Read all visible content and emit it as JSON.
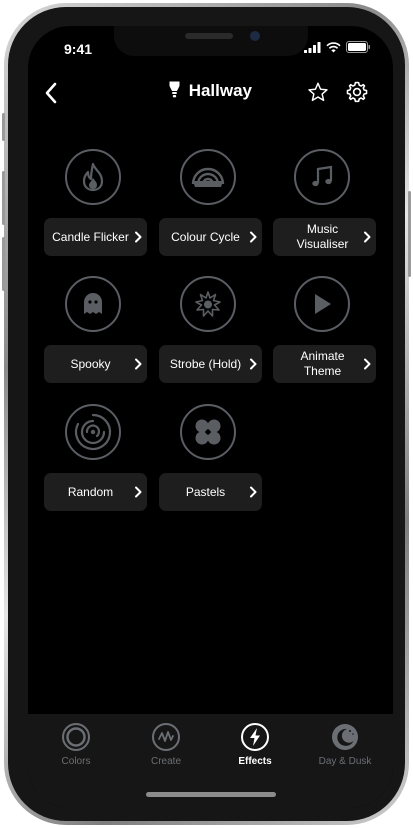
{
  "status": {
    "time": "9:41"
  },
  "header": {
    "title": "Hallway"
  },
  "effects": [
    {
      "label": "Candle Flicker",
      "icon": "flame-icon"
    },
    {
      "label": "Colour Cycle",
      "icon": "rainbow-icon"
    },
    {
      "label": "Music Visualiser",
      "icon": "music-note-icon"
    },
    {
      "label": "Spooky",
      "icon": "ghost-icon"
    },
    {
      "label": "Strobe (Hold)",
      "icon": "strobe-burst-icon"
    },
    {
      "label": "Animate Theme",
      "icon": "play-icon"
    },
    {
      "label": "Random",
      "icon": "random-spiral-icon"
    },
    {
      "label": "Pastels",
      "icon": "petals-icon"
    }
  ],
  "tabs": [
    {
      "label": "Colors",
      "icon": "colors-ring-icon",
      "active": false
    },
    {
      "label": "Create",
      "icon": "create-wave-icon",
      "active": false
    },
    {
      "label": "Effects",
      "icon": "lightning-icon",
      "active": true
    },
    {
      "label": "Day & Dusk",
      "icon": "moon-icon",
      "active": false
    }
  ],
  "colors": {
    "accent_text": "#ffffff",
    "icon_gray": "#5a5e63",
    "card_bg": "#1e1e1e",
    "background": "#000000"
  }
}
